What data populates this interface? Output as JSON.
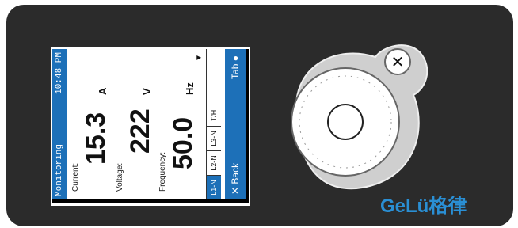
{
  "header": {
    "title": "Monitoring",
    "time": "10:48 PM"
  },
  "readings": [
    {
      "label": "Current:",
      "value": "15.3",
      "unit": "A"
    },
    {
      "label": "Voltage:",
      "value": "222",
      "unit": "V"
    },
    {
      "label": "Frequency:",
      "value": "50.0",
      "unit": "Hz"
    }
  ],
  "tabs": [
    "L1-N",
    "L2-N",
    "L3-N",
    "T/H"
  ],
  "footer": {
    "back": "✕ Back",
    "tab": "Tab ●"
  },
  "brand": {
    "logo": "GeLü格律",
    "accent": "#1d70b8",
    "logo_color": "#2a8fd4"
  },
  "icons": {
    "close": "✕",
    "scroll": "▼"
  }
}
